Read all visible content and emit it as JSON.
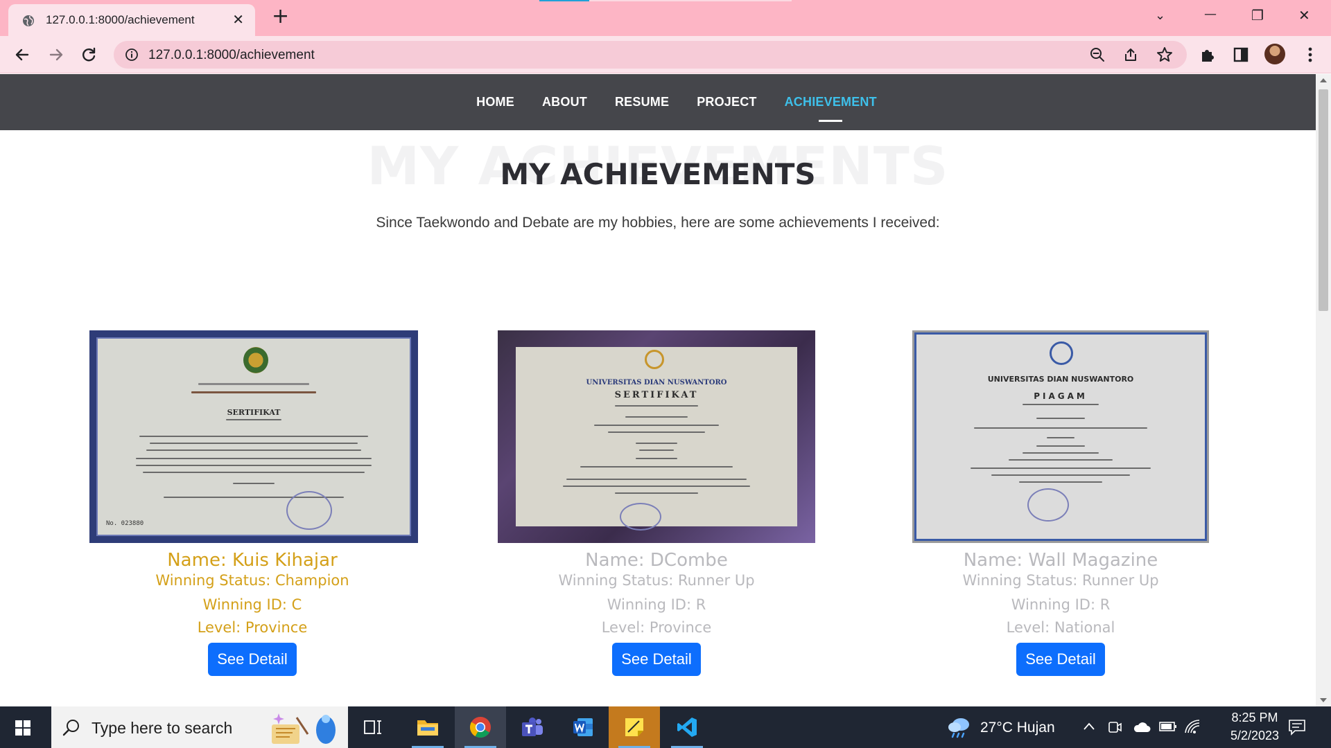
{
  "browser": {
    "tab_title": "127.0.0.1:8000/achievement",
    "tab_close": "✕",
    "new_tab": "+",
    "url": "127.0.0.1:8000/achievement",
    "window_controls": {
      "dropdown": "⌄",
      "minimize": "—",
      "restore": "❐",
      "close": "✕"
    }
  },
  "site_nav": {
    "items": [
      "HOME",
      "ABOUT",
      "RESUME",
      "PROJECT",
      "ACHIEVEMENT"
    ],
    "active": "ACHIEVEMENT",
    "active_color": "#3ec0ea"
  },
  "section": {
    "bg_title": "MY ACHIEVEMENTS",
    "title": "MY ACHIEVEMENTS",
    "subtitle": "Since Taekwondo and Debate are my hobbies, here are some achievements I received:"
  },
  "cards": [
    {
      "name": "Name: Kuis Kihajar",
      "status": "Winning Status: Champion",
      "winning_id": "Winning ID: C",
      "level": "Level: Province",
      "button": "See Detail",
      "text_color": "#d4a019",
      "cert_title": "SERTIFIKAT",
      "cert_no": "No. 023880"
    },
    {
      "name": "Name: DCombe",
      "status": "Winning Status: Runner Up",
      "winning_id": "Winning ID: R",
      "level": "Level: Province",
      "button": "See Detail",
      "text_color": "#b9b9bd",
      "cert_header": "UNIVERSITAS DIAN NUSWANTORO",
      "cert_title": "SERTIFIKAT"
    },
    {
      "name": "Name: Wall Magazine",
      "status": "Winning Status: Runner Up",
      "winning_id": "Winning ID: R",
      "level": "Level: National",
      "button": "See Detail",
      "text_color": "#b9b9bd",
      "cert_header": "UNIVERSITAS DIAN NUSWANTORO",
      "cert_title": "PIAGAM"
    }
  ],
  "taskbar": {
    "search_placeholder": "Type here to search",
    "weather": "27°C  Hujan",
    "time": "8:25 PM",
    "date": "5/2/2023"
  }
}
